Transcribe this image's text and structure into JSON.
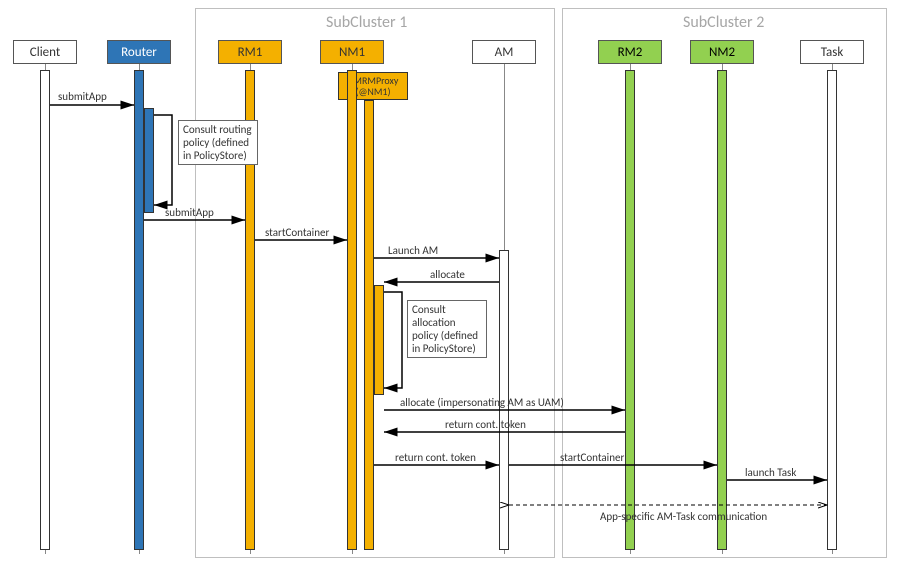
{
  "clusters": {
    "sc1": "SubCluster 1",
    "sc2": "SubCluster 2"
  },
  "participants": {
    "client": "Client",
    "router": "Router",
    "rm1": "RM1",
    "nm1": "NM1",
    "amrmproxy": "AMRMProxy (@NM1)",
    "am": "AM",
    "rm2": "RM2",
    "nm2": "NM2",
    "task": "Task"
  },
  "notes": {
    "routing_policy": "Consult routing policy (defined in PolicyStore)",
    "allocation_policy": "Consult allocation policy (defined in PolicyStore)"
  },
  "messages": {
    "submitApp1": "submitApp",
    "submitApp2": "submitApp",
    "startContainer1": "startContainer",
    "launchAM": "Launch AM",
    "allocate1": "allocate",
    "allocateUAM": "allocate (impersonating  AM as UAM)",
    "returnToken1": "return cont. token",
    "returnToken2": "return cont. token",
    "startContainer2": "startContainer",
    "launchTask": "launch Task",
    "appSpecific": "App-specific AM-Task communication"
  }
}
